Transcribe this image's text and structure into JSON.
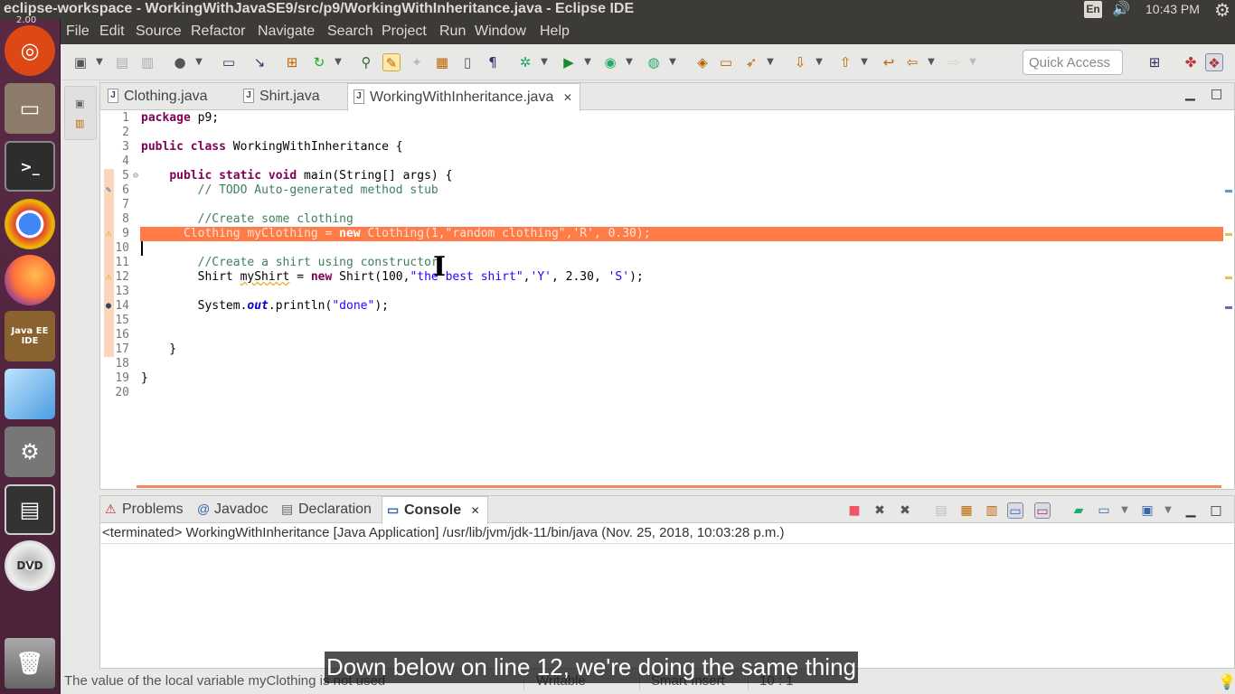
{
  "os": {
    "window_title": "eclipse-workspace - WorkingWithJavaSE9/src/p9/WorkingWithInheritance.java - Eclipse IDE",
    "keyboard_layout": "En",
    "clock": "10:43 PM",
    "launcher_zoom": "2.00",
    "launcher_items": [
      "Ubuntu",
      "Files",
      "Terminal",
      "Chrome",
      "Firefox",
      "Java EE IDE",
      "Cube",
      "Settings",
      "Floppy",
      "DVD",
      "Trash"
    ],
    "eclipse_icon_text": "Java EE IDE",
    "dvd_label": "DVD"
  },
  "menu": [
    "File",
    "Edit",
    "Source",
    "Refactor",
    "Navigate",
    "Search",
    "Project",
    "Run",
    "Window",
    "Help"
  ],
  "toolbar": {
    "quick_access_placeholder": "Quick Access"
  },
  "editor": {
    "tabs": [
      {
        "label": "Clothing.java",
        "active": false
      },
      {
        "label": "Shirt.java",
        "active": false
      },
      {
        "label": "WorkingWithInheritance.java",
        "active": true
      }
    ],
    "line_numbers": [
      "1",
      "2",
      "3",
      "4",
      "5",
      "6",
      "7",
      "8",
      "9",
      "10",
      "11",
      "12",
      "13",
      "14",
      "15",
      "16",
      "17",
      "18",
      "19",
      "20"
    ],
    "highlighted_line": 9
  },
  "bottom_panel": {
    "tabs": [
      {
        "label": "Problems",
        "icon": "problems-icon"
      },
      {
        "label": "Javadoc",
        "icon": "at-icon"
      },
      {
        "label": "Declaration",
        "icon": "declaration-icon"
      },
      {
        "label": "Console",
        "icon": "console-icon",
        "active": true
      }
    ],
    "console_status": "<terminated> WorkingWithInheritance [Java Application] /usr/lib/jvm/jdk-11/bin/java (Nov. 25, 2018, 10:03:28 p.m.)"
  },
  "statusbar": {
    "message": "The value of the local variable myClothing is not used",
    "writable": "Writable",
    "insert_mode": "Smart Insert",
    "position": "10 : 1"
  },
  "subtitle": "Down below on line 12, we're doing the same thing",
  "colors": {
    "highlight_line": "#ff7b47",
    "keyword": "#7f0055",
    "comment": "#3f7f5f",
    "string": "#2a00ff",
    "launcher": "#5a2a44"
  }
}
